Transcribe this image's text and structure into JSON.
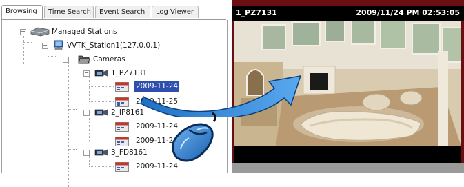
{
  "tabs": [
    {
      "label": "Browsing",
      "active": true
    },
    {
      "label": "Time Search",
      "active": false
    },
    {
      "label": "Event Search",
      "active": false
    },
    {
      "label": "Log Viewer",
      "active": false
    }
  ],
  "tree": {
    "root": "Managed Stations",
    "station": "VVTK_Station1(127.0.0.1)",
    "cameras_folder": "Cameras",
    "cameras": [
      {
        "name": "1_PZ7131",
        "dates": [
          "2009-11-24",
          "2009-11-25"
        ],
        "selected_date": "2009-11-24"
      },
      {
        "name": "2_IP8161",
        "dates": [
          "2009-11-24",
          "2009-11-2"
        ]
      },
      {
        "name": "3_FD8161",
        "dates": [
          "2009-11-24"
        ]
      }
    ]
  },
  "video": {
    "title": "1_PZ7131",
    "timestamp": "2009/11/24 PM 02:53:05"
  },
  "colors": {
    "selection": "#2f4fae",
    "video_frame": "#6a0e14",
    "arrow": "#2e7fd0"
  }
}
